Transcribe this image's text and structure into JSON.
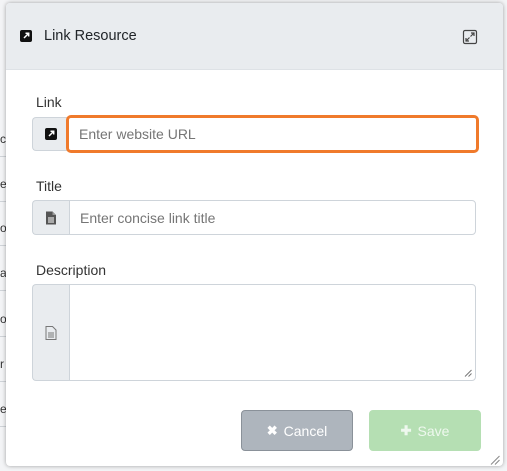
{
  "background": {
    "rows": [
      "c",
      "er",
      "o",
      "a",
      "o",
      "r",
      "el"
    ]
  },
  "modal": {
    "title": "Link Resource",
    "title_icon": "external-link-icon",
    "expand_icon": "expand-icon"
  },
  "form": {
    "link": {
      "label": "Link",
      "icon": "external-link-icon",
      "placeholder": "Enter website URL",
      "value": ""
    },
    "title": {
      "label": "Title",
      "icon": "document-icon",
      "placeholder": "Enter concise link title",
      "value": ""
    },
    "description": {
      "label": "Description",
      "icon": "document-icon",
      "value": ""
    }
  },
  "buttons": {
    "cancel_label": "Cancel",
    "cancel_icon": "✖",
    "save_label": "Save",
    "save_icon": "✚"
  },
  "colors": {
    "focus_ring": "#f07a2b",
    "header_bg": "#e9ecef",
    "cancel_bg": "#aeb5bd",
    "save_bg": "#b5dfb3"
  }
}
